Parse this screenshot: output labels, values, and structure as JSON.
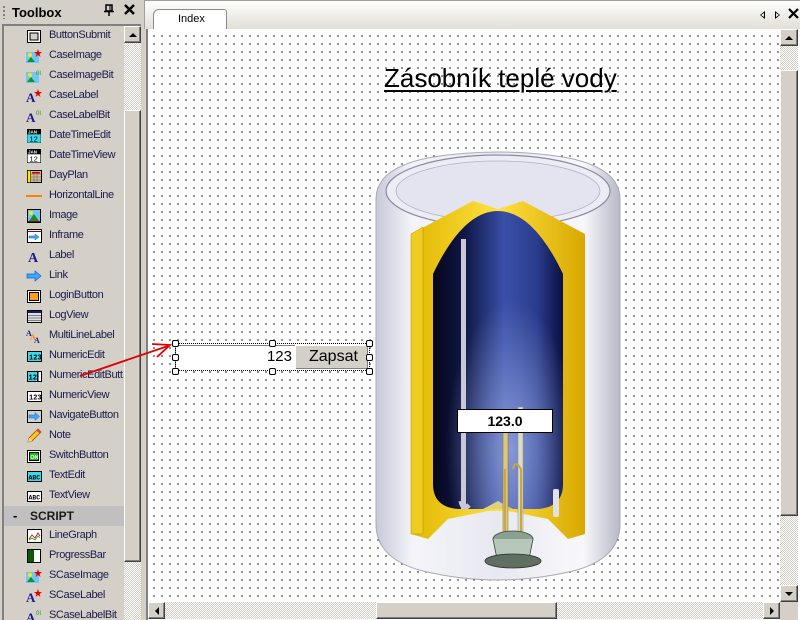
{
  "toolbox": {
    "title": "Toolbox",
    "pin_icon": "pin-icon",
    "close_icon": "close-icon",
    "items": [
      {
        "label": "ButtonSubmit",
        "icon": "button-submit-icon"
      },
      {
        "label": "CaseImage",
        "icon": "case-image-icon"
      },
      {
        "label": "CaseImageBit",
        "icon": "case-image-bit-icon"
      },
      {
        "label": "CaseLabel",
        "icon": "case-label-icon"
      },
      {
        "label": "CaseLabelBit",
        "icon": "case-label-bit-icon"
      },
      {
        "label": "DateTimeEdit",
        "icon": "calendar-edit-icon"
      },
      {
        "label": "DateTimeView",
        "icon": "calendar-view-icon"
      },
      {
        "label": "DayPlan",
        "icon": "day-plan-grid-icon"
      },
      {
        "label": "HorizontalLine",
        "icon": "horizontal-line-icon"
      },
      {
        "label": "Image",
        "icon": "image-icon"
      },
      {
        "label": "Inframe",
        "icon": "inframe-icon"
      },
      {
        "label": "Label",
        "icon": "label-icon"
      },
      {
        "label": "Link",
        "icon": "link-arrow-icon"
      },
      {
        "label": "LoginButton",
        "icon": "login-button-icon"
      },
      {
        "label": "LogView",
        "icon": "log-view-icon"
      },
      {
        "label": "MultiLineLabel",
        "icon": "multiline-label-icon"
      },
      {
        "label": "NumericEdit",
        "icon": "numeric-edit-icon"
      },
      {
        "label": "NumericEditButt",
        "icon": "numeric-edit-button-icon"
      },
      {
        "label": "NumericView",
        "icon": "numeric-view-icon"
      },
      {
        "label": "NavigateButton",
        "icon": "navigate-button-icon"
      },
      {
        "label": "Note",
        "icon": "pencil-icon"
      },
      {
        "label": "SwitchButton",
        "icon": "switch-on-icon"
      },
      {
        "label": "TextEdit",
        "icon": "text-edit-icon"
      },
      {
        "label": "TextView",
        "icon": "text-view-icon"
      }
    ],
    "section": {
      "label": "SCRIPT",
      "toggle": "-"
    },
    "script_items": [
      {
        "label": "LineGraph",
        "icon": "line-graph-icon"
      },
      {
        "label": "ProgressBar",
        "icon": "progress-bar-icon"
      },
      {
        "label": "SCaseImage",
        "icon": "case-image-icon"
      },
      {
        "label": "SCaseLabel",
        "icon": "case-label-icon"
      },
      {
        "label": "SCaseLabelBit",
        "icon": "case-label-bit-icon"
      }
    ]
  },
  "document": {
    "tabs": [
      {
        "label": "Index",
        "active": true
      }
    ],
    "tab_prev_icon": "tab-scroll-left-icon",
    "tab_next_icon": "tab-scroll-right-icon",
    "tab_close_icon": "close-icon",
    "page": {
      "title": "Zásobník teplé vody",
      "image": "water-heater-cutaway",
      "numeric_edit": {
        "value": "123"
      },
      "write_button": {
        "label": "Zapsat"
      },
      "numeric_view": {
        "value": "123.0"
      }
    }
  },
  "colors": {
    "chrome": "#d4d0c8",
    "canvas": "#ffffff",
    "pointer_arrow": "#e00000",
    "heater_yellow": "#f2d51c",
    "heater_blue": "#1c2a78"
  }
}
